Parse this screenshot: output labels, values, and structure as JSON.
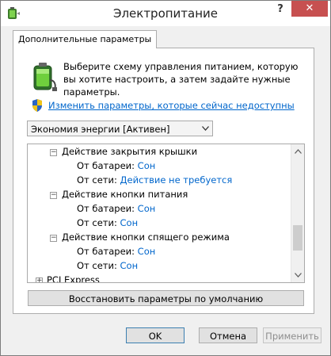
{
  "window": {
    "title": "Электропитание",
    "help_label": "?",
    "close_label": "✕"
  },
  "tab": {
    "label": "Дополнительные параметры"
  },
  "description": "Выберите схему управления питанием, которую вы хотите настроить, а затем задайте нужные параметры.",
  "change_link": "Изменить параметры, которые сейчас недоступны",
  "scheme_select": {
    "value": "Экономия энергии [Активен]"
  },
  "tree": {
    "sections": [
      {
        "title": "Действие закрытия крышки",
        "toggle": "−",
        "on_battery_label": "От батареи:",
        "on_battery_value": "Сон",
        "plugged_in_label": "От сети:",
        "plugged_in_value": "Действие не требуется"
      },
      {
        "title": "Действие кнопки питания",
        "toggle": "−",
        "on_battery_label": "От батареи:",
        "on_battery_value": "Сон",
        "plugged_in_label": "От сети:",
        "plugged_in_value": "Сон"
      },
      {
        "title": "Действие кнопки спящего режима",
        "toggle": "−",
        "on_battery_label": "От батареи:",
        "on_battery_value": "Сон",
        "plugged_in_label": "От сети:",
        "plugged_in_value": "Сон"
      }
    ],
    "next_item": {
      "title": "PCI Express",
      "toggle": "+"
    }
  },
  "buttons": {
    "restore": "Восстановить параметры по умолчанию",
    "ok": "OK",
    "cancel": "Отмена",
    "apply": "Применить"
  }
}
